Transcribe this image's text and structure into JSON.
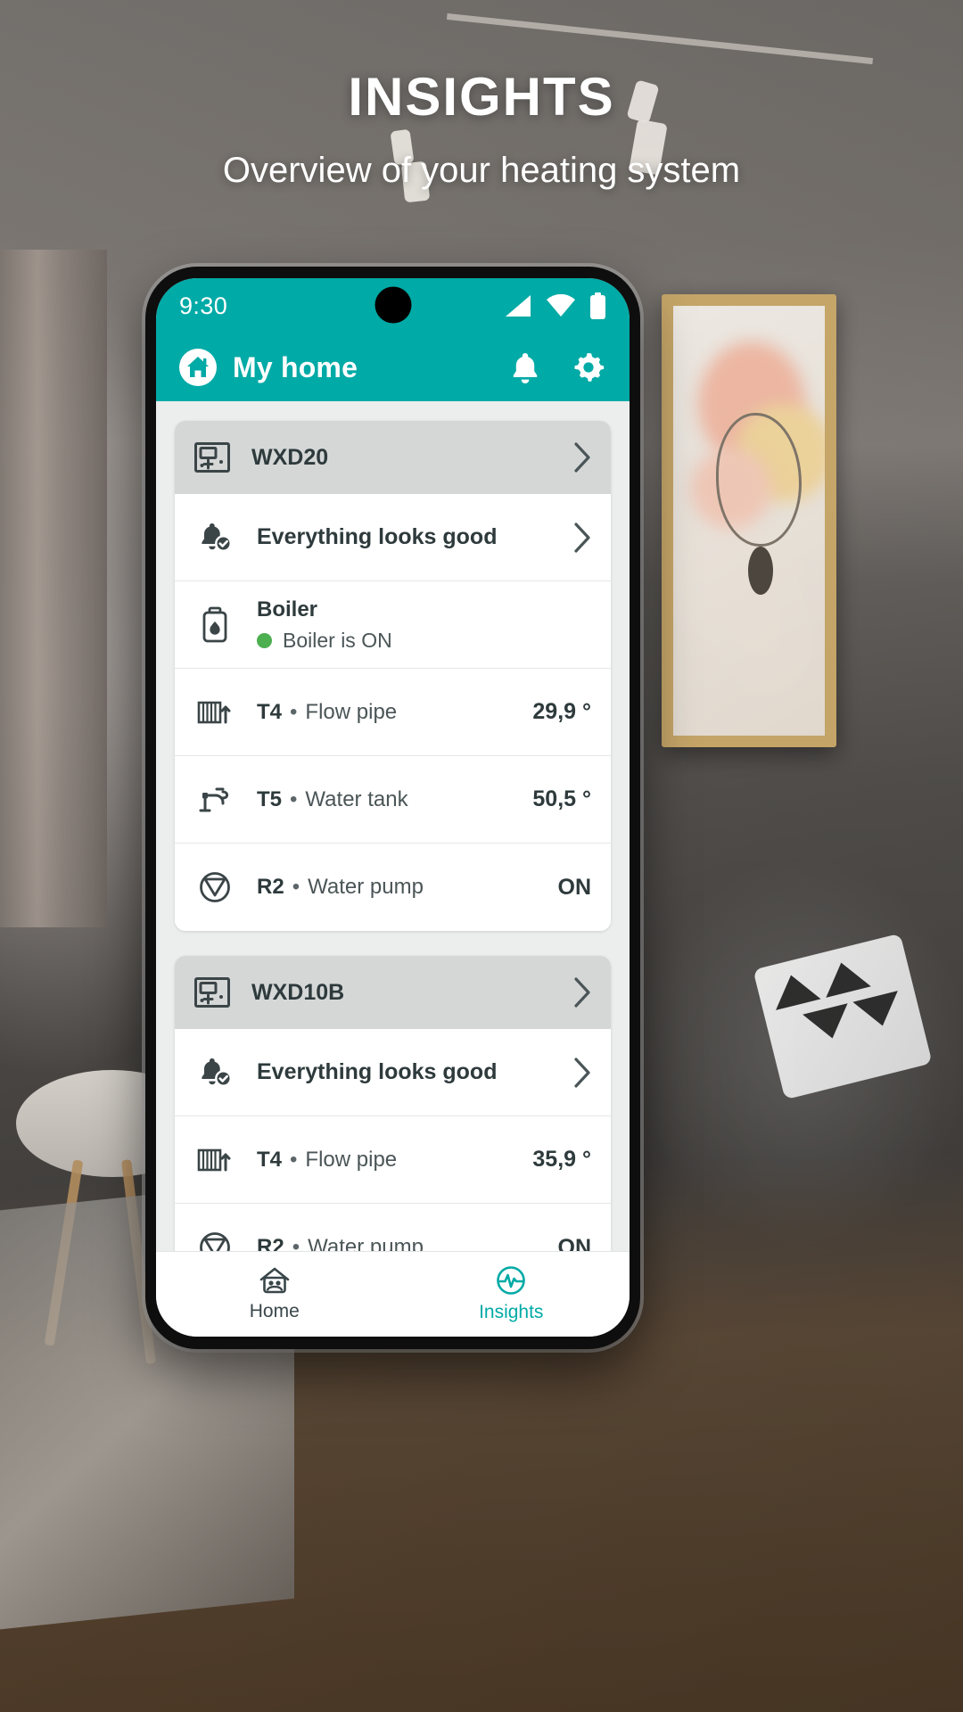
{
  "promo": {
    "headline": "INSIGHTS",
    "subheadline": "Overview of your heating system"
  },
  "theme": {
    "accent": "#00AAA6",
    "status_ok": "#4CAF50",
    "card_header_bg": "#D5D7D7",
    "text_primary": "#2E3A3C"
  },
  "statusbar": {
    "time": "9:30",
    "icons": [
      "signal-icon",
      "wifi-icon",
      "battery-icon"
    ]
  },
  "appbar": {
    "home_icon": "home-icon",
    "title": "My home",
    "actions": [
      {
        "name": "notifications-icon",
        "label": "bell-icon"
      },
      {
        "name": "settings-icon",
        "label": "gear-icon"
      }
    ]
  },
  "cards": [
    {
      "device": "WXD20",
      "device_icon": "controller-icon",
      "rows": [
        {
          "type": "alert",
          "icon": "bell-check-icon",
          "label": "Everything looks good",
          "chevron": true
        },
        {
          "type": "stacked",
          "icon": "boiler-icon",
          "title": "Boiler",
          "status_dot": "#4CAF50",
          "status": "Boiler is ON"
        },
        {
          "type": "value",
          "icon": "radiator-flow-icon",
          "code": "T4",
          "name": "Flow pipe",
          "value": "29,9 °"
        },
        {
          "type": "value",
          "icon": "faucet-icon",
          "code": "T5",
          "name": "Water tank",
          "value": "50,5 °"
        },
        {
          "type": "value",
          "icon": "pump-icon",
          "code": "R2",
          "name": "Water pump",
          "value": "ON"
        }
      ]
    },
    {
      "device": "WXD10B",
      "device_icon": "controller-icon",
      "rows": [
        {
          "type": "alert",
          "icon": "bell-check-icon",
          "label": "Everything looks good",
          "chevron": true
        },
        {
          "type": "value",
          "icon": "radiator-flow-icon",
          "code": "T4",
          "name": "Flow pipe",
          "value": "35,9 °"
        },
        {
          "type": "value",
          "icon": "pump-icon",
          "code": "R2",
          "name": "Water pump",
          "value": "ON"
        }
      ]
    }
  ],
  "bottomnav": {
    "items": [
      {
        "icon": "home-outline-icon",
        "label": "Home",
        "active": false
      },
      {
        "icon": "insights-pulse-icon",
        "label": "Insights",
        "active": true
      }
    ]
  },
  "separator": "•"
}
